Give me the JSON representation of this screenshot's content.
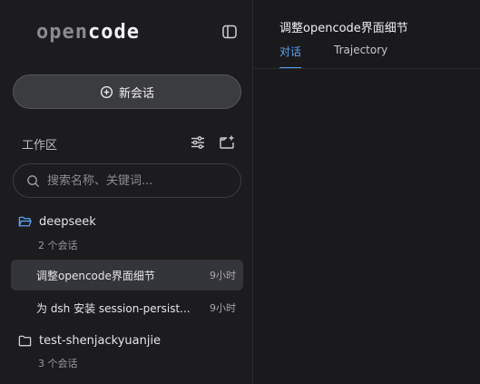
{
  "app": {
    "logo_open": "open",
    "logo_code": "code"
  },
  "sidebar": {
    "new_chat_label": "新会话",
    "workspace_label": "工作区",
    "search_placeholder": "搜索名称、关键词...",
    "groups": [
      {
        "name": "deepseek",
        "count_label": "2 个会话",
        "sessions": [
          {
            "title": "调整opencode界面细节",
            "time": "9小时"
          },
          {
            "title": "为 dsh 安装 session-persist...",
            "time": "9小时"
          }
        ]
      },
      {
        "name": "test-shenjackyuanjie",
        "count_label": "3 个会话"
      }
    ]
  },
  "main": {
    "title": "调整opencode界面细节",
    "tabs": [
      {
        "label": "对话"
      },
      {
        "label": "Trajectory"
      }
    ]
  },
  "colors": {
    "accent": "#5aa0f5",
    "folder_open": "#5aa0f5"
  }
}
